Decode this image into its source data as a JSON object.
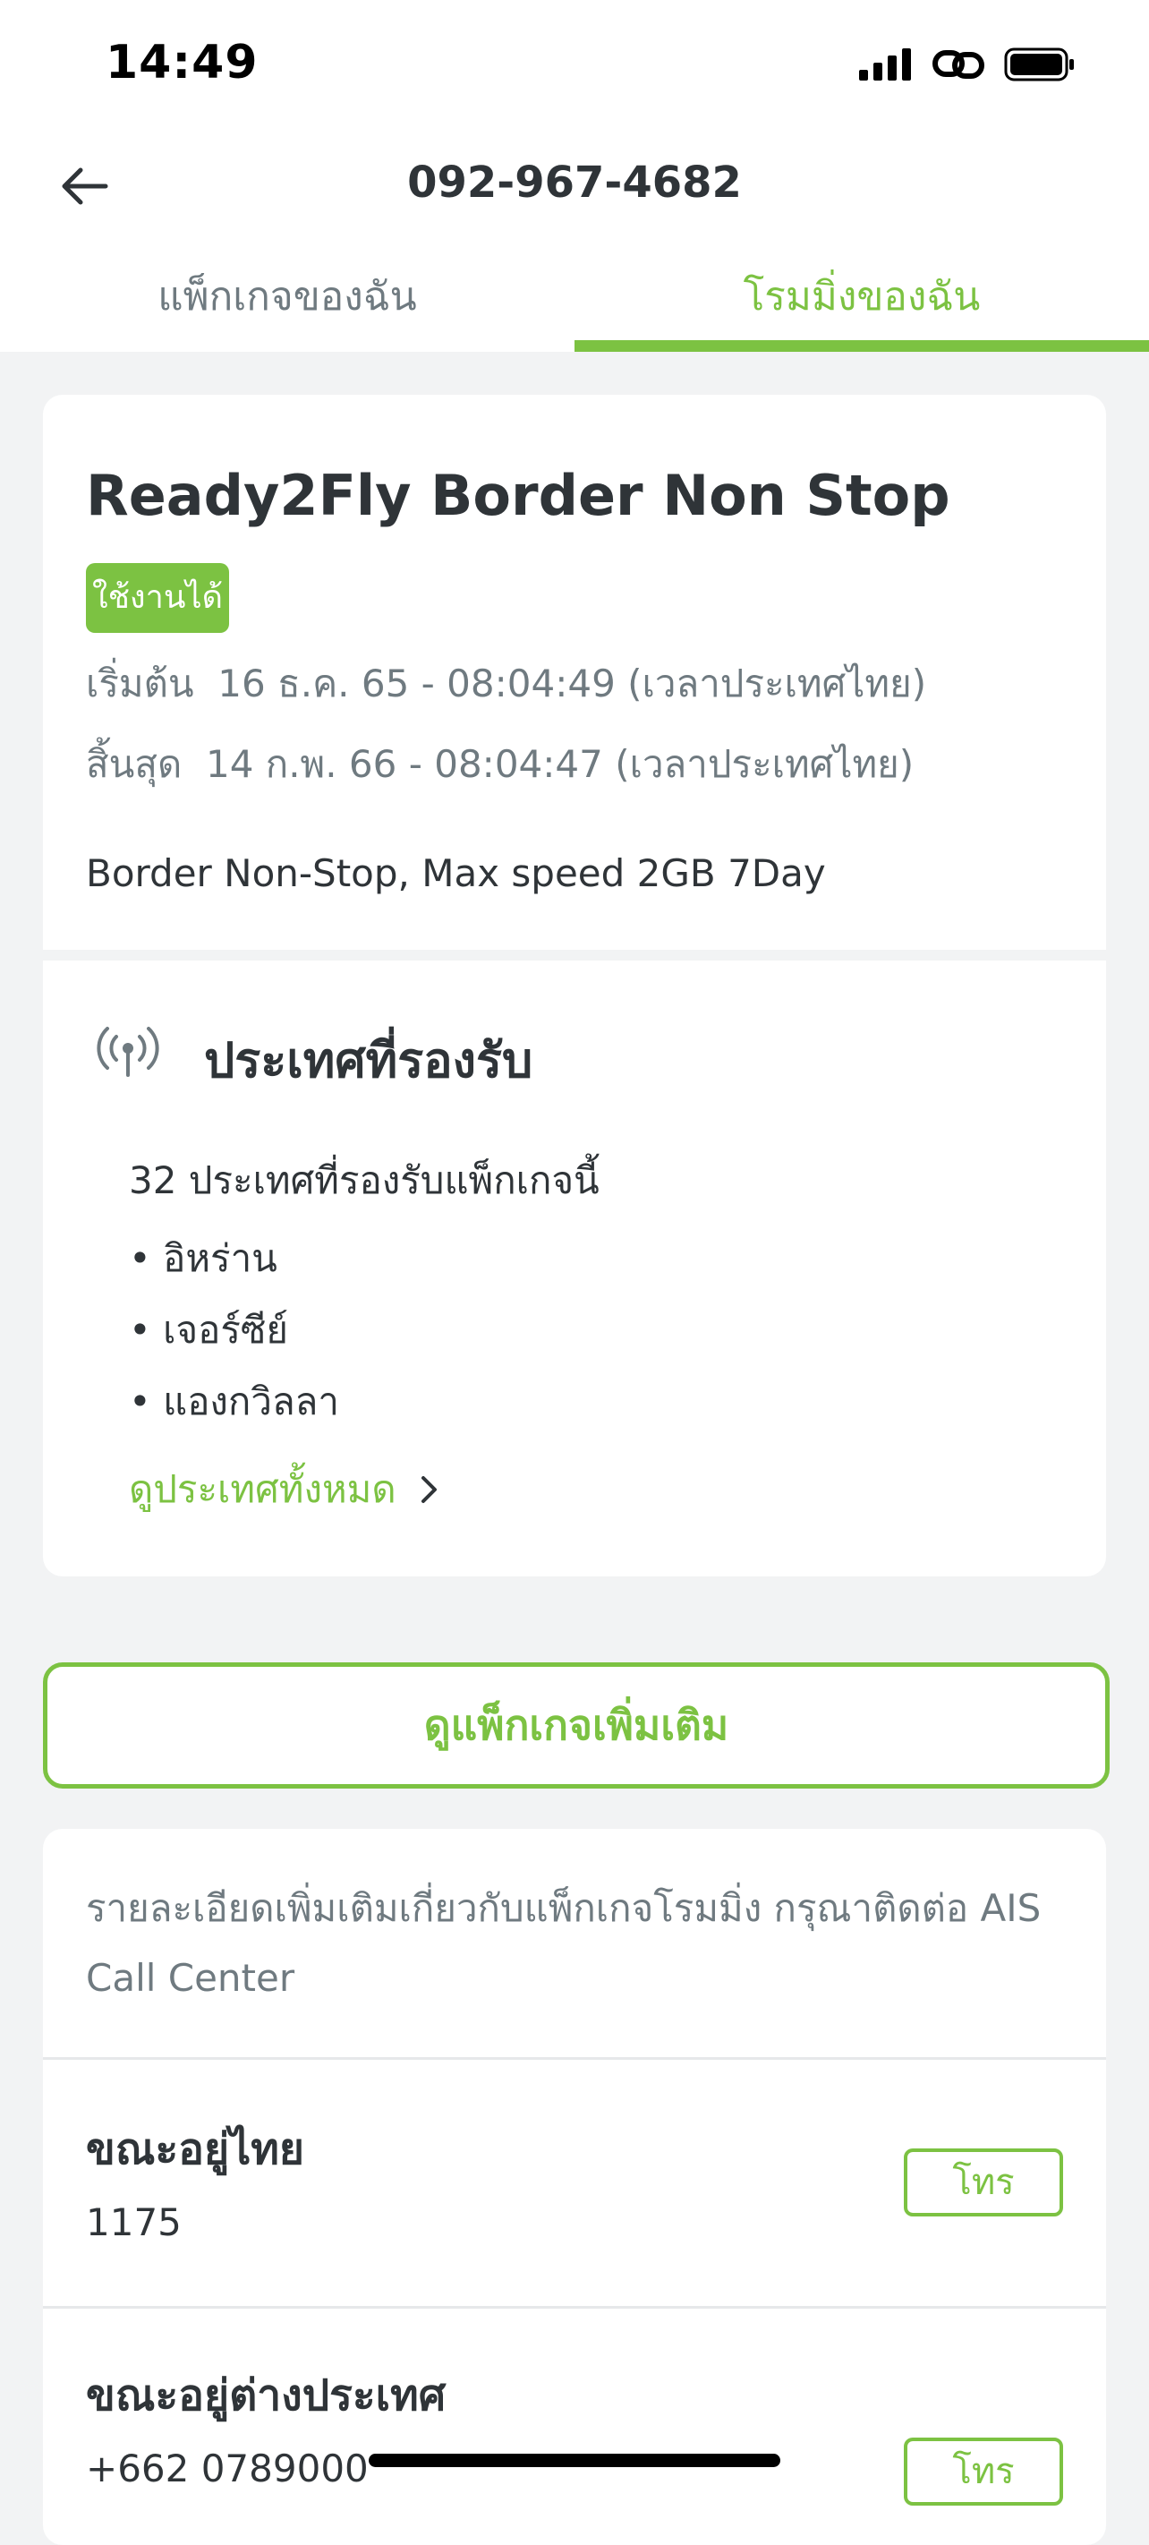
{
  "status_bar": {
    "time": "14:49"
  },
  "header": {
    "title": "092-967-4682"
  },
  "tabs": [
    {
      "label": "แพ็กเกจของฉัน",
      "active": false
    },
    {
      "label": "โรมมิ่งของฉัน",
      "active": true
    }
  ],
  "package": {
    "name": "Ready2Fly Border Non Stop",
    "status": "ใช้งานได้",
    "start_label": "เริ่มต้น",
    "start_value": "16 ธ.ค. 65 - 08:04:49 (เวลาประเทศไทย)",
    "end_label": "สิ้นสุด",
    "end_value": "14 ก.พ. 66 - 08:04:47 (เวลาประเทศไทย)",
    "description": "Border Non-Stop, Max speed 2GB 7Day"
  },
  "countries": {
    "title": "ประเทศที่รองรับ",
    "count_text": "32 ประเทศที่รองรับแพ็กเกจนี้",
    "items": [
      "• อิหร่าน",
      "• เจอร์ซีย์",
      "• แองกวิลลา"
    ],
    "see_all": "ดูประเทศทั้งหมด"
  },
  "more_packages_label": "ดูแพ็กเกจเพิ่มเติม",
  "contact": {
    "info": "รายละเอียดเพิ่มเติมเกี่ยวกับแพ็กเกจโรมมิ่ง กรุณาติดต่อ AIS Call Center",
    "rows": [
      {
        "label": "ขณะอยู่ไทย",
        "number": "1175",
        "button": "โทร"
      },
      {
        "label": "ขณะอยู่ต่างประเทศ",
        "number": "+662 0789000",
        "button": "โทร"
      }
    ]
  },
  "colors": {
    "accent": "#7cc242",
    "text": "#2f3438",
    "muted": "#6f7a80",
    "background": "#f2f3f4"
  }
}
